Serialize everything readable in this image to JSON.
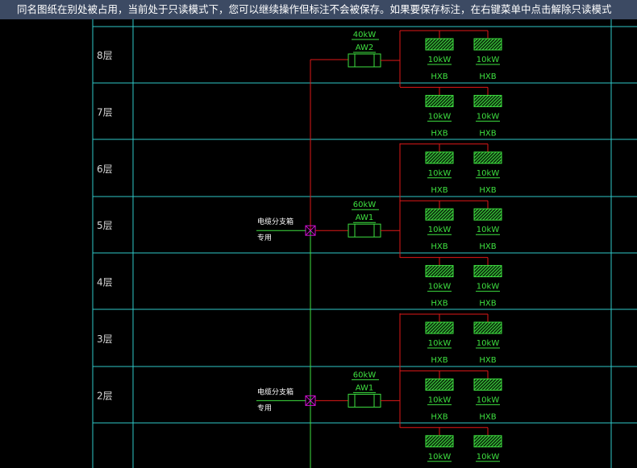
{
  "banner": {
    "message": "同名图纸在别处被占用，当前处于只读模式下，您可以继续操作但标注不会被保存。如果要保存标注，在右键菜单中点击解除只读模式"
  },
  "floors": [
    "8层",
    "7层",
    "6层",
    "5层",
    "4层",
    "3层",
    "2层"
  ],
  "panels": [
    {
      "power": "40kW",
      "name": "AW2",
      "floor_index": 0
    },
    {
      "power": "60kW",
      "name": "AW1",
      "floor_index": 3
    },
    {
      "power": "60kW",
      "name": "AW1",
      "floor_index": 6
    }
  ],
  "junction_boxes": [
    {
      "title": "电缆分支箱",
      "note": "专用",
      "floor_index": 3
    },
    {
      "title": "电缆分支箱",
      "note": "专用",
      "floor_index": 6
    }
  ],
  "unit": {
    "power": "10kW",
    "type": "HXB"
  },
  "colors": {
    "background": "#000000",
    "banner": "#3c4a63",
    "grid": "#2fc8c8",
    "wire": "#e01818",
    "equipment": "#3ee040",
    "junction": "#d010d0",
    "text": "#ffffff"
  }
}
